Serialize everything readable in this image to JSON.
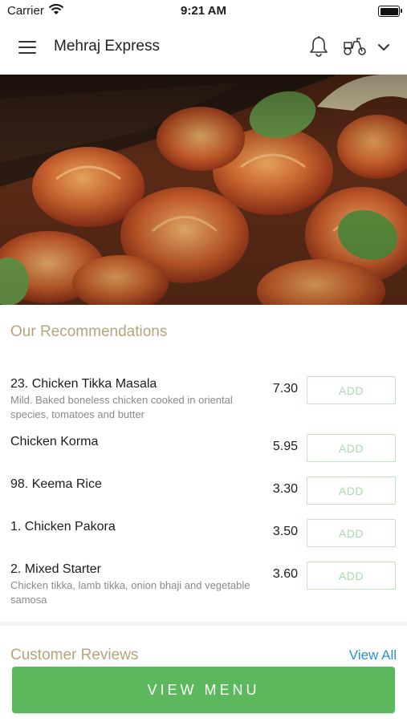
{
  "status_bar": {
    "carrier": "Carrier",
    "time": "9:21 AM"
  },
  "navbar": {
    "title": "Mehraj Express",
    "icons": [
      "menu-icon",
      "bell-icon",
      "scooter-icon",
      "chevron-down-icon"
    ]
  },
  "hero": {
    "icon": "food-photo-king-prawns"
  },
  "recommendations": {
    "title": "Our Recommendations",
    "items": [
      {
        "name": "23. Chicken Tikka Masala",
        "desc": "Mild. Baked boneless chicken cooked in oriental species, tomatoes and butter",
        "price": "7.30",
        "button": "ADD"
      },
      {
        "name": "Chicken Korma",
        "desc": "",
        "price": "5.95",
        "button": "ADD"
      },
      {
        "name": "98. Keema Rice",
        "desc": "",
        "price": "3.30",
        "button": "ADD"
      },
      {
        "name": "1. Chicken Pakora",
        "desc": "",
        "price": "3.50",
        "button": "ADD"
      },
      {
        "name": "2. Mixed Starter",
        "desc": "Chicken tikka, lamb tikka, onion bhaji and vegetable samosa",
        "price": "3.60",
        "button": "ADD"
      }
    ]
  },
  "reviews": {
    "title": "Customer Reviews",
    "view_all": "View All"
  },
  "footer": {
    "view_menu": "VIEW MENU"
  },
  "colors": {
    "accent_green": "#5cb85c",
    "section_title": "#b4a57e",
    "link_blue": "#2a8fd0"
  }
}
